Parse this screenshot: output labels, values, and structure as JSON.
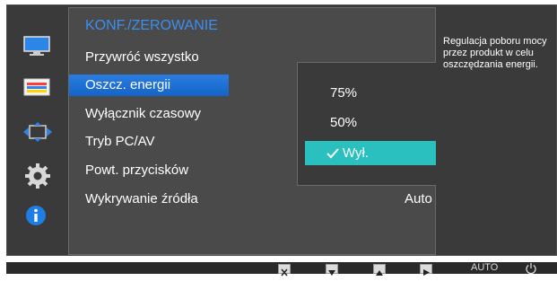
{
  "menu": {
    "title": "KONF./ZEROWANIE",
    "items": [
      {
        "label": "Przywróć wszystko",
        "value": ""
      },
      {
        "label": "Oszcz. energii",
        "value": ""
      },
      {
        "label": "Wyłącznik czasowy",
        "value": ""
      },
      {
        "label": "Tryb PC/AV",
        "value": ""
      },
      {
        "label": "Powt. przycisków",
        "value": ""
      },
      {
        "label": "Wykrywanie źródła",
        "value": "Auto"
      }
    ],
    "selected_index": 1
  },
  "submenu": {
    "options": [
      "75%",
      "50%",
      "Wył."
    ],
    "selected_index": 2
  },
  "help": {
    "text": "Regulacja poboru mocy przez produkt w celu oszczędzania energii."
  },
  "side_icons": [
    "picture-icon",
    "color-icon",
    "screen-size-icon",
    "settings-gear-icon",
    "info-icon"
  ],
  "bottom_bar": {
    "buttons": [
      "close-icon",
      "down-arrow-icon",
      "up-arrow-icon",
      "play-right-icon"
    ],
    "auto_label": "AUTO",
    "power_icon": "power-icon"
  },
  "colors": {
    "accent_blue": "#3b8ff0",
    "selected_highlight": "#29c0bf",
    "panel_bg": "#4a4a4a",
    "osd_bg": "#3a3a3a"
  }
}
